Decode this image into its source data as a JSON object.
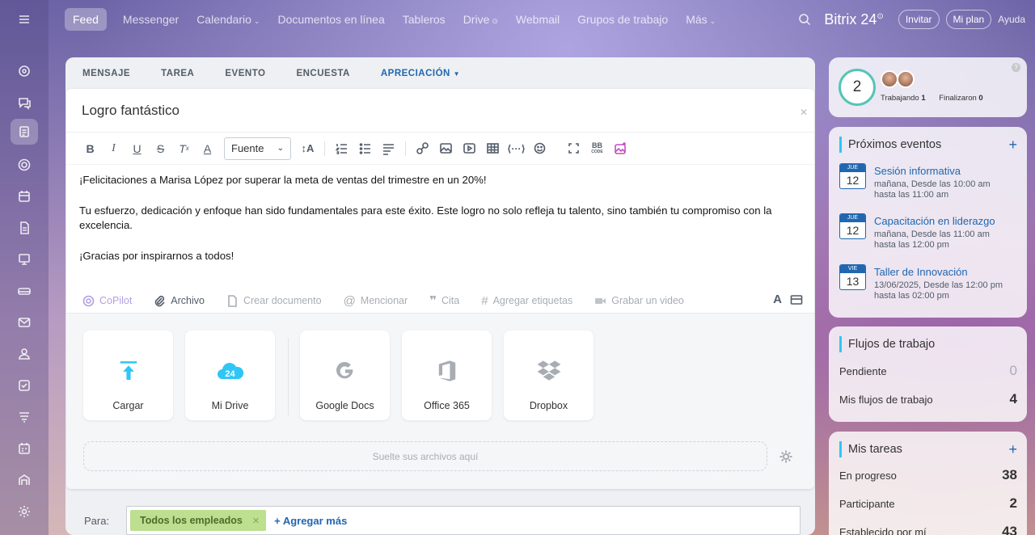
{
  "nav": {
    "items": [
      "Feed",
      "Messenger",
      "Calendario",
      "Documentos en línea",
      "Tableros",
      "Drive",
      "Webmail",
      "Grupos de trabajo",
      "Más"
    ],
    "brand": "Bitrix 24",
    "invite": "Invitar",
    "plan": "Mi plan",
    "help": "Ayuda"
  },
  "composer": {
    "tabs": [
      "MENSAJE",
      "TAREA",
      "EVENTO",
      "ENCUESTA",
      "APRECIACIÓN"
    ],
    "title": "Logro fantástico",
    "font_label": "Fuente",
    "paragraphs": [
      "¡Felicitaciones a Marisa López por superar la meta de ventas del trimestre en un 20%!",
      "Tu esfuerzo, dedicación y enfoque han sido fundamentales para este éxito. Este logro no solo refleja tu talento, sino también tu compromiso con la excelencia.",
      "¡Gracias por inspirarnos a todos!"
    ],
    "actions": {
      "copilot": "CoPilot",
      "archivo": "Archivo",
      "crear_documento": "Crear documento",
      "mencionar": "Mencionar",
      "cita": "Cita",
      "etiquetas": "Agregar etiquetas",
      "video": "Grabar un video"
    },
    "uploads": {
      "cargar": "Cargar",
      "mi_drive": "Mi Drive",
      "drive_badge": "24",
      "google_docs": "Google Docs",
      "office": "Office 365",
      "dropbox": "Dropbox",
      "dropzone": "Suelte sus archivos aquí"
    },
    "para_label": "Para:",
    "recipient": "Todos los empleados",
    "add_more": "+ Agregar más"
  },
  "sidebar": {
    "counter": "2",
    "working_label": "Trabajando",
    "working_count": "1",
    "finished_label": "Finalizaron",
    "finished_count": "0",
    "events_title": "Próximos eventos",
    "events": [
      {
        "month": "JUE",
        "day": "12",
        "name": "Sesión informativa",
        "line1": "mañana, Desde las 10:00 am",
        "line2": "hasta las 11:00 am"
      },
      {
        "month": "JUE",
        "day": "12",
        "name": "Capacitación en liderazgo",
        "line1": "mañana, Desde las 11:00 am",
        "line2": "hasta las 12:00 pm"
      },
      {
        "month": "VIE",
        "day": "13",
        "name": "Taller de Innovación",
        "line1": "13/06/2025, Desde las 12:00 pm",
        "line2": "hasta las 02:00 pm"
      }
    ],
    "flows_title": "Flujos de trabajo",
    "flows": [
      {
        "label": "Pendiente",
        "value": "0"
      },
      {
        "label": "Mis flujos de trabajo",
        "value": "4"
      }
    ],
    "tasks_title": "Mis tareas",
    "tasks": [
      {
        "label": "En progreso",
        "value": "38"
      },
      {
        "label": "Participante",
        "value": "2"
      },
      {
        "label": "Establecido por mí",
        "value": "43"
      }
    ]
  },
  "colors": {
    "accent": "#2067b0",
    "chip": "#bcdf90",
    "counter_ring": "#56c4b7"
  }
}
